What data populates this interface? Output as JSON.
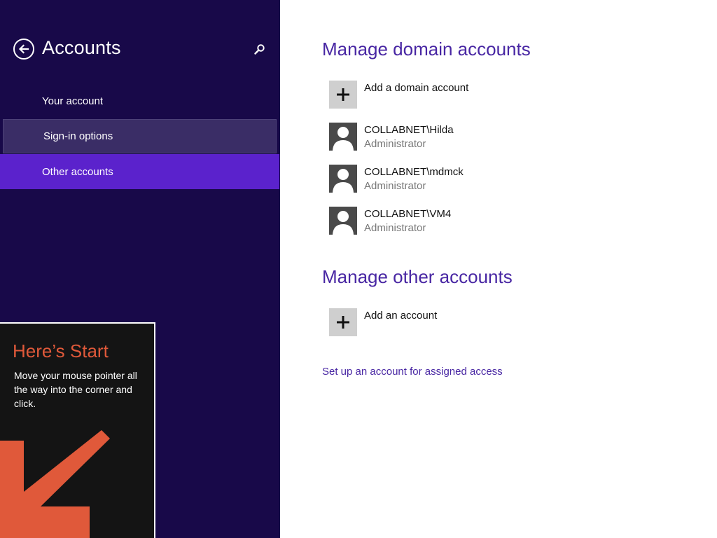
{
  "sidebar": {
    "title": "Accounts",
    "back_icon": "back-arrow-icon",
    "search_icon": "search-icon",
    "items": [
      {
        "label": "Your account",
        "state": "normal"
      },
      {
        "label": "Sign-in options",
        "state": "hover"
      },
      {
        "label": "Other accounts",
        "state": "selected"
      }
    ],
    "colors": {
      "background": "#180949",
      "selected": "#5b22cc",
      "hover": "#3a2d66"
    }
  },
  "start_tip": {
    "title": "Here’s Start",
    "body": "Move your mouse pointer all the way into the corner and click.",
    "arrow_icon": "corner-arrow-icon",
    "colors": {
      "background": "#141414",
      "accent": "#e0593a"
    }
  },
  "main": {
    "domain_section": {
      "title": "Manage domain accounts",
      "add_label": "Add a domain account",
      "accounts": [
        {
          "name": "COLLABNET\\Hilda",
          "role": "Administrator"
        },
        {
          "name": "COLLABNET\\mdmck",
          "role": "Administrator"
        },
        {
          "name": "COLLABNET\\VM4",
          "role": "Administrator"
        }
      ]
    },
    "other_section": {
      "title": "Manage other accounts",
      "add_label": "Add an account"
    },
    "assigned_access_link": "Set up an account for assigned access",
    "colors": {
      "heading": "#4826a3",
      "link": "#4826a3"
    }
  }
}
